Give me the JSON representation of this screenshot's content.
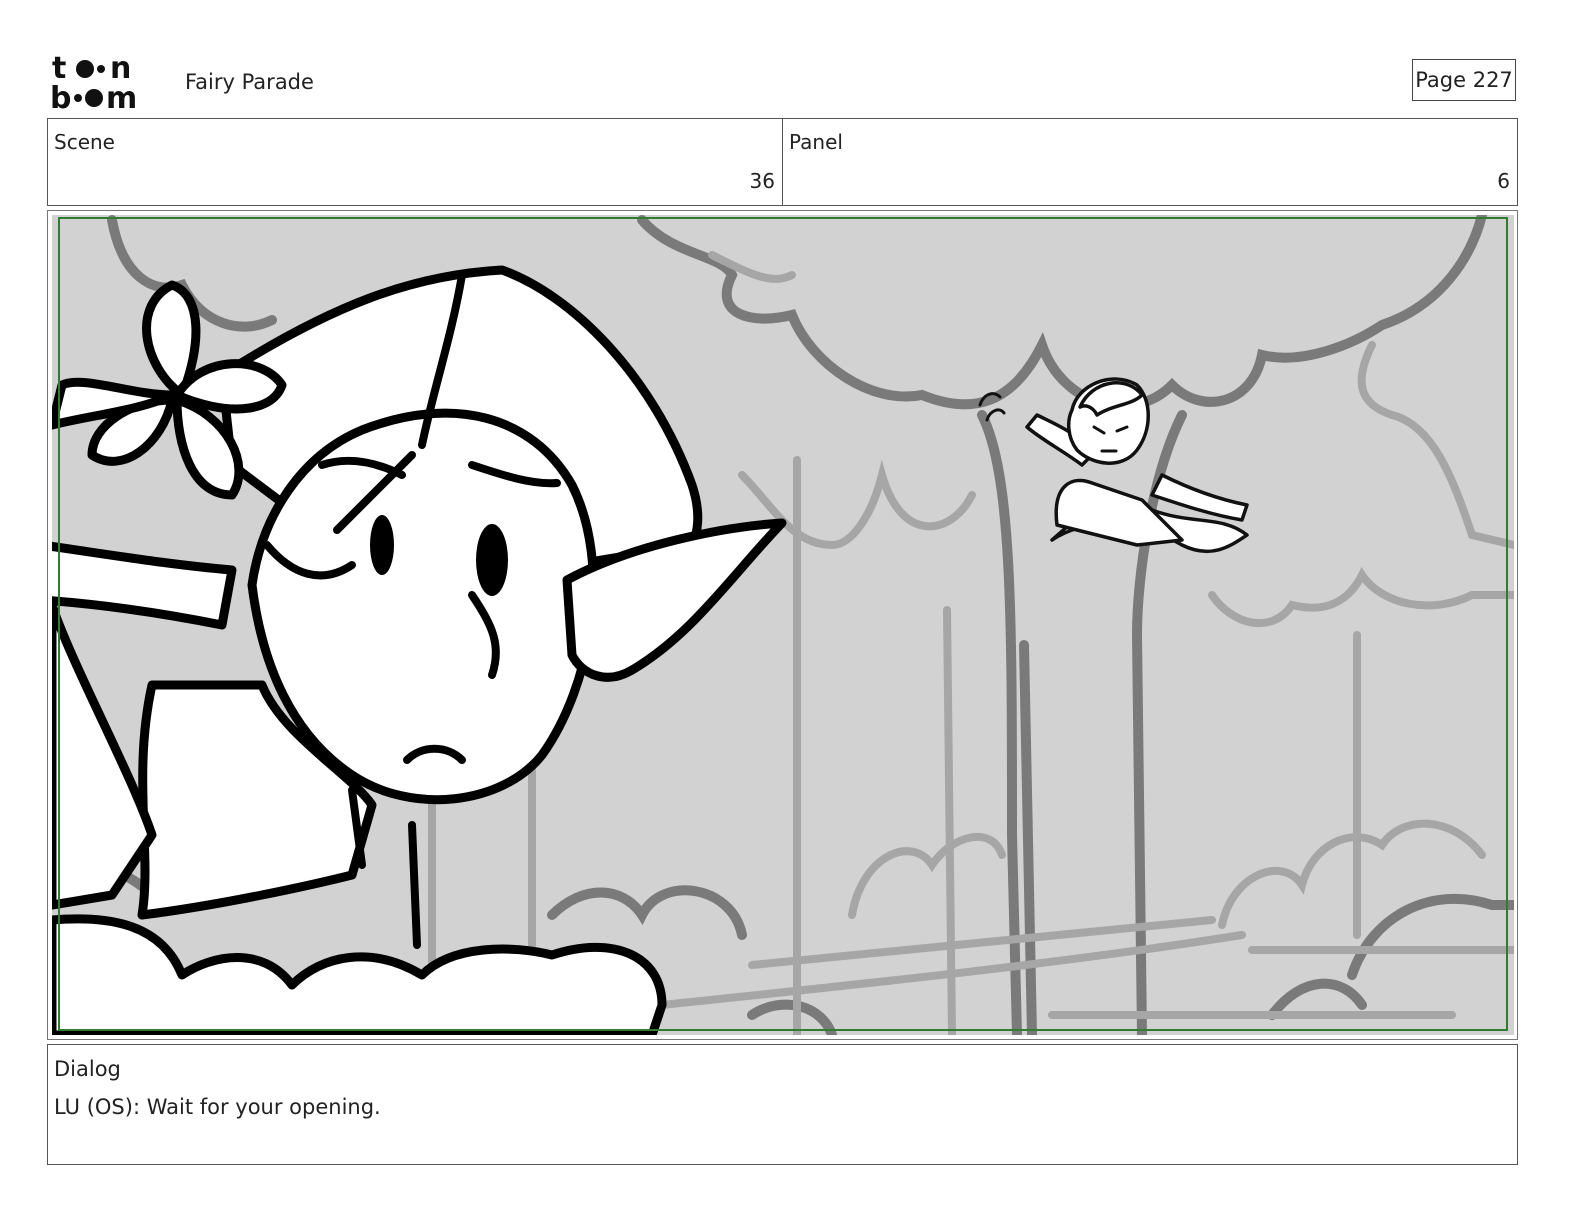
{
  "header": {
    "logo_text": "toon boom",
    "project_title": "Fairy Parade",
    "page_label": "Page 227"
  },
  "info": {
    "scene_label": "Scene",
    "scene_value": "36",
    "panel_label": "Panel",
    "panel_value": "6"
  },
  "panel": {
    "safe_frame_color": "#2e7d32",
    "background_color": "#d2d2d2"
  },
  "dialog": {
    "label": "Dialog",
    "text": "LU (OS): Wait for your opening."
  }
}
